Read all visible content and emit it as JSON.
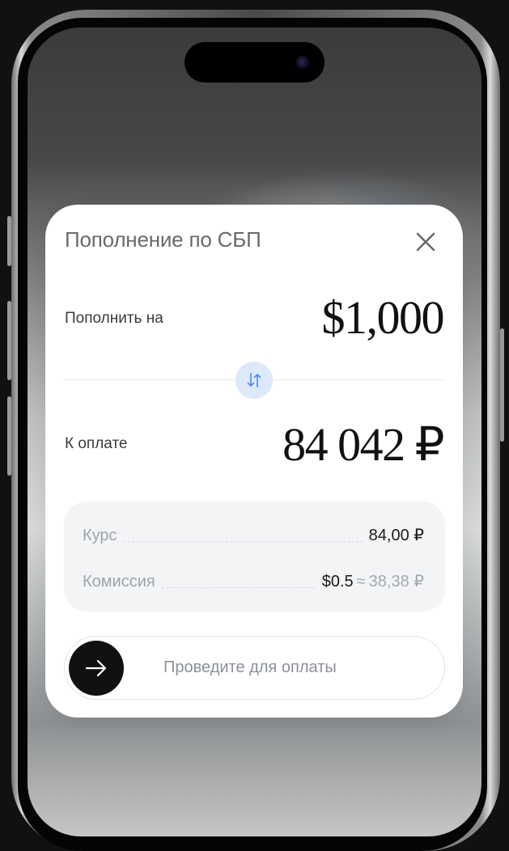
{
  "modal": {
    "title": "Пополнение по СБП",
    "close_icon": "close-icon"
  },
  "topup": {
    "label": "Пополнить на",
    "amount": "$1,000"
  },
  "swap_icon": "swap-arrows-icon",
  "payment": {
    "label": "К оплате",
    "amount": "84 042 ₽"
  },
  "details": {
    "rate_label": "Курс",
    "rate_value": "84,00 ₽",
    "fee_label": "Комиссия",
    "fee_value": "$0.5",
    "fee_approx_sign": "≈",
    "fee_converted": "38,38 ₽"
  },
  "slider": {
    "label": "Проведите для оплаты",
    "icon": "arrow-right-icon"
  },
  "colors": {
    "accent_light": "#dde9fb",
    "accent_icon": "#4d8ef0",
    "knob": "#111111"
  }
}
